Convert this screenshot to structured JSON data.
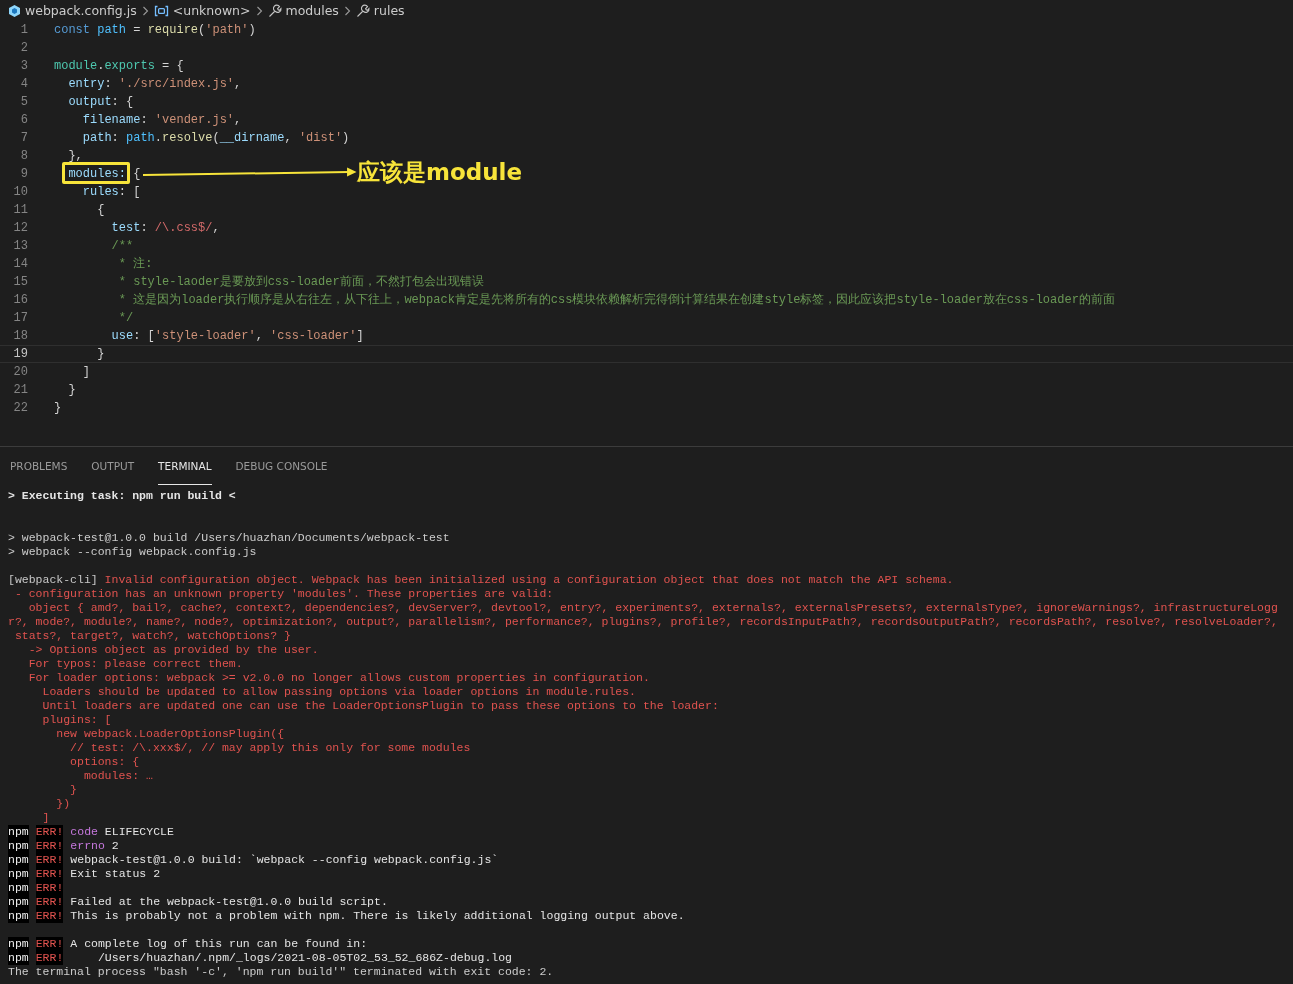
{
  "breadcrumb": [
    {
      "kind": "file",
      "text": "webpack.config.js"
    },
    {
      "kind": "symbol",
      "text": "<unknown>"
    },
    {
      "kind": "property",
      "text": "modules"
    },
    {
      "kind": "property",
      "text": "rules"
    }
  ],
  "editor": {
    "lines": [
      {
        "number": "1",
        "current": false,
        "tokens": [
          {
            "kind": "kw",
            "text": "const "
          },
          {
            "kind": "var",
            "text": "path"
          },
          {
            "kind": "punct",
            "text": " = "
          },
          {
            "kind": "fn",
            "text": "require"
          },
          {
            "kind": "punct",
            "text": "("
          },
          {
            "kind": "str",
            "text": "'path'"
          },
          {
            "kind": "punct",
            "text": ")"
          }
        ]
      },
      {
        "number": "2",
        "current": false
      },
      {
        "number": "3",
        "current": false,
        "tokens": [
          {
            "kind": "type",
            "text": "module"
          },
          {
            "kind": "punct",
            "text": "."
          },
          {
            "kind": "type",
            "text": "exports"
          },
          {
            "kind": "punct",
            "text": " = {"
          }
        ]
      },
      {
        "number": "4",
        "current": false,
        "tokens": [
          {
            "kind": "prop",
            "text": "  entry"
          },
          {
            "kind": "punct",
            "text": ": "
          },
          {
            "kind": "str",
            "text": "'./src/index.js'"
          },
          {
            "kind": "punct",
            "text": ","
          }
        ]
      },
      {
        "number": "5",
        "current": false,
        "tokens": [
          {
            "kind": "prop",
            "text": "  output"
          },
          {
            "kind": "punct",
            "text": ": {"
          }
        ]
      },
      {
        "number": "6",
        "current": false,
        "tokens": [
          {
            "kind": "prop",
            "text": "    filename"
          },
          {
            "kind": "punct",
            "text": ": "
          },
          {
            "kind": "str",
            "text": "'vender.js'"
          },
          {
            "kind": "punct",
            "text": ","
          }
        ]
      },
      {
        "number": "7",
        "current": false,
        "tokens": [
          {
            "kind": "prop",
            "text": "    path"
          },
          {
            "kind": "punct",
            "text": ": "
          },
          {
            "kind": "var",
            "text": "path"
          },
          {
            "kind": "punct",
            "text": "."
          },
          {
            "kind": "fn",
            "text": "resolve"
          },
          {
            "kind": "punct",
            "text": "("
          },
          {
            "kind": "prop",
            "text": "__dirname"
          },
          {
            "kind": "punct",
            "text": ", "
          },
          {
            "kind": "str",
            "text": "'dist'"
          },
          {
            "kind": "punct",
            "text": ")"
          }
        ]
      },
      {
        "number": "8",
        "current": false,
        "tokens": [
          {
            "kind": "punct",
            "text": "  },"
          }
        ]
      },
      {
        "number": "9",
        "current": false,
        "tokens": [
          {
            "kind": "prop",
            "text": "  modules:",
            "boxed": true
          },
          {
            "kind": "punct",
            "text": " {"
          }
        ]
      },
      {
        "number": "10",
        "current": false,
        "tokens": [
          {
            "kind": "prop",
            "text": "    rules"
          },
          {
            "kind": "punct",
            "text": ": ["
          }
        ]
      },
      {
        "number": "11",
        "current": false,
        "tokens": [
          {
            "kind": "punct",
            "text": "      {"
          }
        ]
      },
      {
        "number": "12",
        "current": false,
        "tokens": [
          {
            "kind": "prop",
            "text": "        test"
          },
          {
            "kind": "punct",
            "text": ": "
          },
          {
            "kind": "regex",
            "text": "/\\.css$/"
          },
          {
            "kind": "punct",
            "text": ","
          }
        ]
      },
      {
        "number": "13",
        "current": false,
        "tokens": [
          {
            "kind": "comment",
            "text": "        /**"
          }
        ]
      },
      {
        "number": "14",
        "current": false,
        "tokens": [
          {
            "kind": "comment",
            "text": "         * 注:"
          }
        ]
      },
      {
        "number": "15",
        "current": false,
        "tokens": [
          {
            "kind": "comment",
            "text": "         * style-laoder是要放到css-loader前面，不然打包会出现错误"
          }
        ]
      },
      {
        "number": "16",
        "current": false,
        "tokens": [
          {
            "kind": "comment",
            "text": "         * 这是因为loader执行顺序是从右往左，从下往上，webpack肯定是先将所有的css模块依赖解析完得倒计算结果在创建style标签，因此应该把style-loader放在css-loader的前面"
          }
        ]
      },
      {
        "number": "17",
        "current": false,
        "tokens": [
          {
            "kind": "comment",
            "text": "         */"
          }
        ]
      },
      {
        "number": "18",
        "current": false,
        "tokens": [
          {
            "kind": "prop",
            "text": "        use"
          },
          {
            "kind": "punct",
            "text": ": ["
          },
          {
            "kind": "str",
            "text": "'style-loader'"
          },
          {
            "kind": "punct",
            "text": ", "
          },
          {
            "kind": "str",
            "text": "'css-loader'"
          },
          {
            "kind": "punct",
            "text": "]"
          }
        ]
      },
      {
        "number": "19",
        "current": true,
        "tokens": [
          {
            "kind": "punct",
            "text": "      }"
          }
        ]
      },
      {
        "number": "20",
        "current": false,
        "tokens": [
          {
            "kind": "punct",
            "text": "    ]"
          }
        ]
      },
      {
        "number": "21",
        "current": false,
        "tokens": [
          {
            "kind": "punct",
            "text": "  }"
          }
        ]
      },
      {
        "number": "22",
        "current": false,
        "tokens": [
          {
            "kind": "punct",
            "text": "}"
          }
        ]
      }
    ],
    "annotation": {
      "text": "应该是module"
    }
  },
  "panel": {
    "tabs": [
      {
        "label": "PROBLEMS",
        "selected": false
      },
      {
        "label": "OUTPUT",
        "selected": false
      },
      {
        "label": "TERMINAL",
        "selected": true
      },
      {
        "label": "DEBUG CONSOLE",
        "selected": false
      }
    ],
    "terminal": [
      {
        "kind": "task",
        "text": "> Executing task: npm run build <"
      },
      {
        "kind": "blank"
      },
      {
        "kind": "blank"
      },
      {
        "kind": "plain",
        "text": "> webpack-test@1.0.0 build /Users/huazhan/Documents/webpack-test"
      },
      {
        "kind": "plain",
        "text": "> webpack --config webpack.config.js"
      },
      {
        "kind": "blank"
      },
      {
        "kind": "error",
        "prefix": "[webpack-cli]",
        "text": " Invalid configuration object. Webpack has been initialized using a configuration object that does not match the API schema."
      },
      {
        "kind": "error",
        "text": " - configuration has an unknown property 'modules'. These properties are valid:"
      },
      {
        "kind": "error",
        "text": "   object { amd?, bail?, cache?, context?, dependencies?, devServer?, devtool?, entry?, experiments?, externals?, externalsPresets?, externalsType?, ignoreWarnings?, infrastructureLogg"
      },
      {
        "kind": "error",
        "text": "r?, mode?, module?, name?, node?, optimization?, output?, parallelism?, performance?, plugins?, profile?, recordsInputPath?, recordsOutputPath?, recordsPath?, resolve?, resolveLoader?,"
      },
      {
        "kind": "error",
        "text": " stats?, target?, watch?, watchOptions? }"
      },
      {
        "kind": "error",
        "text": "   -> Options object as provided by the user."
      },
      {
        "kind": "error",
        "text": "   For typos: please correct them."
      },
      {
        "kind": "error",
        "text": "   For loader options: webpack >= v2.0.0 no longer allows custom properties in configuration."
      },
      {
        "kind": "error",
        "text": "     Loaders should be updated to allow passing options via loader options in module.rules."
      },
      {
        "kind": "error",
        "text": "     Until loaders are updated one can use the LoaderOptionsPlugin to pass these options to the loader:"
      },
      {
        "kind": "error",
        "text": "     plugins: ["
      },
      {
        "kind": "error",
        "text": "       new webpack.LoaderOptionsPlugin({"
      },
      {
        "kind": "error",
        "text": "         // test: /\\.xxx$/, // may apply this only for some modules"
      },
      {
        "kind": "error",
        "text": "         options: {"
      },
      {
        "kind": "error",
        "text": "           modules: …"
      },
      {
        "kind": "error",
        "text": "         }"
      },
      {
        "kind": "error",
        "text": "       })"
      },
      {
        "kind": "error",
        "text": "     ]"
      },
      {
        "kind": "npm",
        "prefix": "npm",
        "tag": "ERR!",
        "key": "code",
        "text": "ELIFECYCLE"
      },
      {
        "kind": "npm",
        "prefix": "npm",
        "tag": "ERR!",
        "key": "errno",
        "text": "2"
      },
      {
        "kind": "npm",
        "prefix": "npm",
        "tag": "ERR!",
        "text": "webpack-test@1.0.0 build: `webpack --config webpack.config.js`"
      },
      {
        "kind": "npm",
        "prefix": "npm",
        "tag": "ERR!",
        "text": "Exit status 2"
      },
      {
        "kind": "npm",
        "prefix": "npm",
        "tag": "ERR!"
      },
      {
        "kind": "npm",
        "prefix": "npm",
        "tag": "ERR!",
        "text": "Failed at the webpack-test@1.0.0 build script."
      },
      {
        "kind": "npm",
        "prefix": "npm",
        "tag": "ERR!",
        "text": "This is probably not a problem with npm. There is likely additional logging output above."
      },
      {
        "kind": "blank"
      },
      {
        "kind": "npm",
        "prefix": "npm",
        "tag": "ERR!",
        "text": "A complete log of this run can be found in:"
      },
      {
        "kind": "npm",
        "prefix": "npm",
        "tag": "ERR!",
        "text": "    /Users/huazhan/.npm/_logs/2021-08-05T02_53_52_686Z-debug.log"
      },
      {
        "kind": "plain",
        "text": "The terminal process \"bash '-c', 'npm run build'\" terminated with exit code: 2."
      }
    ]
  }
}
